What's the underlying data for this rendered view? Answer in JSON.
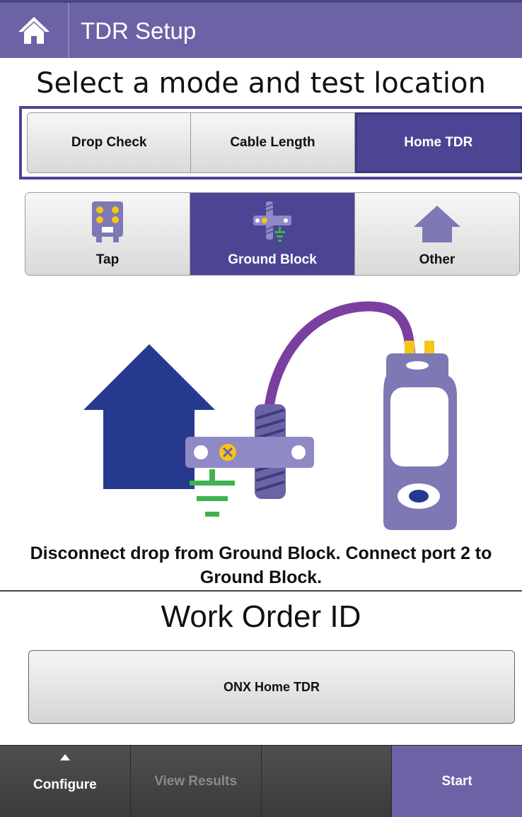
{
  "header": {
    "title": "TDR Setup",
    "home_icon": "home-icon"
  },
  "subtitle": "Select a mode and test location",
  "modes": [
    {
      "label": "Drop Check",
      "active": false
    },
    {
      "label": "Cable Length",
      "active": false
    },
    {
      "label": "Home TDR",
      "active": true
    }
  ],
  "locations": [
    {
      "label": "Tap",
      "icon": "tap-icon",
      "active": false
    },
    {
      "label": "Ground Block",
      "icon": "ground-block-icon",
      "active": true
    },
    {
      "label": "Other",
      "icon": "house-icon",
      "active": false
    }
  ],
  "instruction": "Disconnect drop from Ground Block.  Connect port 2 to Ground Block.",
  "work_order": {
    "label": "Work Order ID",
    "value": "ONX Home TDR"
  },
  "bottom_bar": {
    "configure": "Configure",
    "view_results": "View Results",
    "empty": "",
    "start": "Start"
  },
  "colors": {
    "header": "#6b63a6",
    "selected": "#4b4594",
    "house": "#27398f",
    "cable": "#7b3fa0",
    "device": "#7e78b4",
    "ground": "#3fb34f",
    "connector": "#f5c518"
  }
}
